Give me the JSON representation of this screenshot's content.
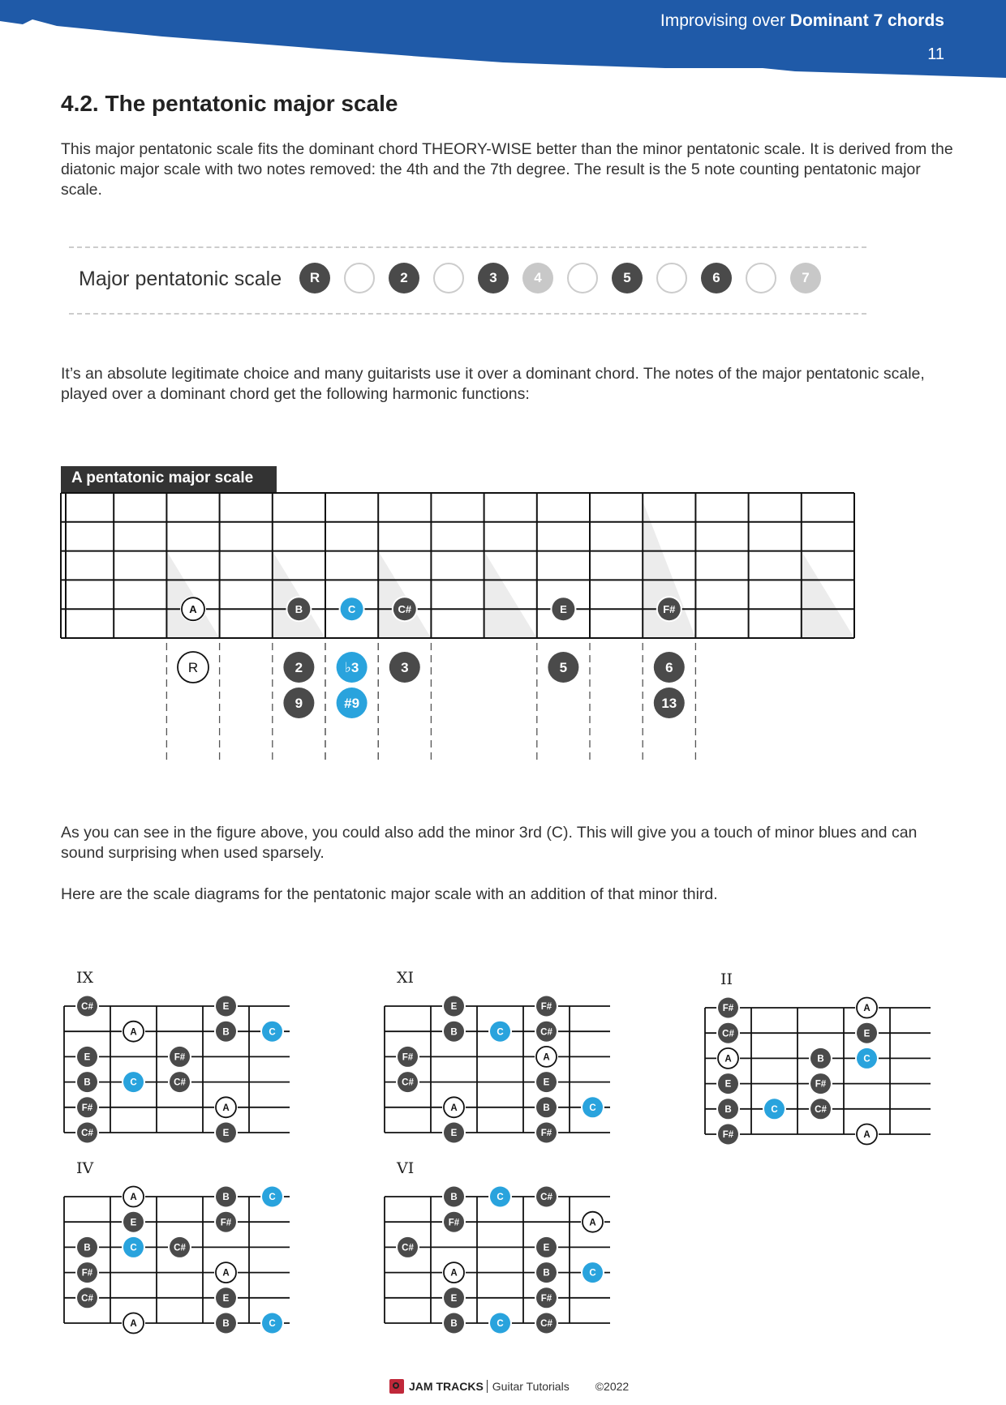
{
  "header": {
    "title_light": "Improvising over ",
    "title_bold": "Dominant 7 chords",
    "page_number": "11",
    "brand_color": "#1f5aa8"
  },
  "section": {
    "heading": "4.2. The pentatonic major scale",
    "intro": "This major pentatonic scale fits the dominant chord THEORY-WISE better than the minor pentatonic scale. It is derived from the diatonic major scale with two notes removed: the 4th and the 7th degree. The result is the 5 note counting pentatonic major scale."
  },
  "scale_strip": {
    "label": "Major pentatonic scale",
    "degrees": [
      {
        "label": "R",
        "state": "in"
      },
      {
        "label": "",
        "state": "empty"
      },
      {
        "label": "2",
        "state": "in"
      },
      {
        "label": "",
        "state": "empty"
      },
      {
        "label": "3",
        "state": "in"
      },
      {
        "label": "4",
        "state": "out"
      },
      {
        "label": "",
        "state": "empty"
      },
      {
        "label": "5",
        "state": "in"
      },
      {
        "label": "",
        "state": "empty"
      },
      {
        "label": "6",
        "state": "in"
      },
      {
        "label": "",
        "state": "empty"
      },
      {
        "label": "7",
        "state": "out"
      }
    ]
  },
  "para2": "It’s  an absolute legitimate choice and many guitarists use it over a dominant chord. The notes of the major pentatonic scale, played over a dominant chord get the following harmonic functions:",
  "fretboard": {
    "title": "A pentatonic major scale",
    "marker_frets": [
      3,
      5,
      7,
      9,
      12,
      15
    ],
    "notes": [
      {
        "fret": 3,
        "name": "A",
        "type": "root"
      },
      {
        "fret": 5,
        "name": "B",
        "type": "note"
      },
      {
        "fret": 6,
        "name": "C",
        "type": "blue"
      },
      {
        "fret": 7,
        "name": "C#",
        "type": "note"
      },
      {
        "fret": 10,
        "name": "E",
        "type": "note"
      },
      {
        "fret": 12,
        "name": "F#",
        "type": "note"
      }
    ],
    "functions": [
      {
        "fret": 3,
        "labels": [
          "R"
        ],
        "type": "root"
      },
      {
        "fret": 5,
        "labels": [
          "2",
          "9"
        ],
        "type": "note"
      },
      {
        "fret": 6,
        "labels": [
          "♭3",
          "#9"
        ],
        "type": "blue"
      },
      {
        "fret": 7,
        "labels": [
          "3"
        ],
        "type": "note"
      },
      {
        "fret": 10,
        "labels": [
          "5"
        ],
        "type": "note"
      },
      {
        "fret": 12,
        "labels": [
          "6",
          "13"
        ],
        "type": "note"
      }
    ]
  },
  "para3": "As you can see in the figure above, you could also add the minor 3rd (C). This will give you a touch of minor blues and can sound surprising when used sparsely.",
  "para4": "Here are the scale diagrams for the pentatonic major scale with an addition of that minor third.",
  "diagrams": [
    {
      "position": "IX",
      "notes": [
        {
          "s": 0,
          "c": 0,
          "n": "C#",
          "t": "note"
        },
        {
          "s": 0,
          "c": 3,
          "n": "E",
          "t": "note"
        },
        {
          "s": 1,
          "c": 1,
          "n": "A",
          "t": "root"
        },
        {
          "s": 1,
          "c": 3,
          "n": "B",
          "t": "note"
        },
        {
          "s": 1,
          "c": 4,
          "n": "C",
          "t": "blue"
        },
        {
          "s": 2,
          "c": 0,
          "n": "E",
          "t": "note"
        },
        {
          "s": 2,
          "c": 2,
          "n": "F#",
          "t": "note"
        },
        {
          "s": 3,
          "c": 0,
          "n": "B",
          "t": "note"
        },
        {
          "s": 3,
          "c": 1,
          "n": "C",
          "t": "blue"
        },
        {
          "s": 3,
          "c": 2,
          "n": "C#",
          "t": "note"
        },
        {
          "s": 4,
          "c": 0,
          "n": "F#",
          "t": "note"
        },
        {
          "s": 4,
          "c": 3,
          "n": "A",
          "t": "root"
        },
        {
          "s": 5,
          "c": 0,
          "n": "C#",
          "t": "note"
        },
        {
          "s": 5,
          "c": 3,
          "n": "E",
          "t": "note"
        }
      ]
    },
    {
      "position": "XI",
      "notes": [
        {
          "s": 0,
          "c": 1,
          "n": "E",
          "t": "note"
        },
        {
          "s": 0,
          "c": 3,
          "n": "F#",
          "t": "note"
        },
        {
          "s": 1,
          "c": 1,
          "n": "B",
          "t": "note"
        },
        {
          "s": 1,
          "c": 2,
          "n": "C",
          "t": "blue"
        },
        {
          "s": 1,
          "c": 3,
          "n": "C#",
          "t": "note"
        },
        {
          "s": 2,
          "c": 0,
          "n": "F#",
          "t": "note"
        },
        {
          "s": 2,
          "c": 3,
          "n": "A",
          "t": "root"
        },
        {
          "s": 3,
          "c": 0,
          "n": "C#",
          "t": "note"
        },
        {
          "s": 3,
          "c": 3,
          "n": "E",
          "t": "note"
        },
        {
          "s": 4,
          "c": 1,
          "n": "A",
          "t": "root"
        },
        {
          "s": 4,
          "c": 3,
          "n": "B",
          "t": "note"
        },
        {
          "s": 4,
          "c": 4,
          "n": "C",
          "t": "blue"
        },
        {
          "s": 5,
          "c": 1,
          "n": "E",
          "t": "note"
        },
        {
          "s": 5,
          "c": 3,
          "n": "F#",
          "t": "note"
        }
      ]
    },
    {
      "position": "II",
      "notes": [
        {
          "s": 0,
          "c": 0,
          "n": "F#",
          "t": "note"
        },
        {
          "s": 0,
          "c": 3,
          "n": "A",
          "t": "root"
        },
        {
          "s": 1,
          "c": 0,
          "n": "C#",
          "t": "note"
        },
        {
          "s": 1,
          "c": 3,
          "n": "E",
          "t": "note"
        },
        {
          "s": 2,
          "c": 0,
          "n": "A",
          "t": "root"
        },
        {
          "s": 2,
          "c": 2,
          "n": "B",
          "t": "note"
        },
        {
          "s": 2,
          "c": 3,
          "n": "C",
          "t": "blue"
        },
        {
          "s": 3,
          "c": 0,
          "n": "E",
          "t": "note"
        },
        {
          "s": 3,
          "c": 2,
          "n": "F#",
          "t": "note"
        },
        {
          "s": 4,
          "c": 0,
          "n": "B",
          "t": "note"
        },
        {
          "s": 4,
          "c": 1,
          "n": "C",
          "t": "blue"
        },
        {
          "s": 4,
          "c": 2,
          "n": "C#",
          "t": "note"
        },
        {
          "s": 5,
          "c": 0,
          "n": "F#",
          "t": "note"
        },
        {
          "s": 5,
          "c": 3,
          "n": "A",
          "t": "root"
        }
      ]
    },
    {
      "position": "IV",
      "notes": [
        {
          "s": 0,
          "c": 1,
          "n": "A",
          "t": "root"
        },
        {
          "s": 0,
          "c": 3,
          "n": "B",
          "t": "note"
        },
        {
          "s": 0,
          "c": 4,
          "n": "C",
          "t": "blue"
        },
        {
          "s": 1,
          "c": 1,
          "n": "E",
          "t": "note"
        },
        {
          "s": 1,
          "c": 3,
          "n": "F#",
          "t": "note"
        },
        {
          "s": 2,
          "c": 0,
          "n": "B",
          "t": "note"
        },
        {
          "s": 2,
          "c": 1,
          "n": "C",
          "t": "blue"
        },
        {
          "s": 2,
          "c": 2,
          "n": "C#",
          "t": "note"
        },
        {
          "s": 3,
          "c": 0,
          "n": "F#",
          "t": "note"
        },
        {
          "s": 3,
          "c": 3,
          "n": "A",
          "t": "root"
        },
        {
          "s": 4,
          "c": 0,
          "n": "C#",
          "t": "note"
        },
        {
          "s": 4,
          "c": 3,
          "n": "E",
          "t": "note"
        },
        {
          "s": 5,
          "c": 1,
          "n": "A",
          "t": "root"
        },
        {
          "s": 5,
          "c": 3,
          "n": "B",
          "t": "note"
        },
        {
          "s": 5,
          "c": 4,
          "n": "C",
          "t": "blue"
        }
      ]
    },
    {
      "position": "VI",
      "notes": [
        {
          "s": 0,
          "c": 1,
          "n": "B",
          "t": "note"
        },
        {
          "s": 0,
          "c": 2,
          "n": "C",
          "t": "blue"
        },
        {
          "s": 0,
          "c": 3,
          "n": "C#",
          "t": "note"
        },
        {
          "s": 1,
          "c": 1,
          "n": "F#",
          "t": "note"
        },
        {
          "s": 1,
          "c": 4,
          "n": "A",
          "t": "root"
        },
        {
          "s": 2,
          "c": 0,
          "n": "C#",
          "t": "note"
        },
        {
          "s": 2,
          "c": 3,
          "n": "E",
          "t": "note"
        },
        {
          "s": 3,
          "c": 1,
          "n": "A",
          "t": "root"
        },
        {
          "s": 3,
          "c": 3,
          "n": "B",
          "t": "note"
        },
        {
          "s": 3,
          "c": 4,
          "n": "C",
          "t": "blue"
        },
        {
          "s": 4,
          "c": 1,
          "n": "E",
          "t": "note"
        },
        {
          "s": 4,
          "c": 3,
          "n": "F#",
          "t": "note"
        },
        {
          "s": 5,
          "c": 1,
          "n": "B",
          "t": "note"
        },
        {
          "s": 5,
          "c": 2,
          "n": "C",
          "t": "blue"
        },
        {
          "s": 5,
          "c": 3,
          "n": "C#",
          "t": "note"
        }
      ]
    }
  ],
  "footer": {
    "brand": "JAM TRACKS",
    "product": "Guitar Tutorials",
    "copyright": "©2022"
  },
  "colors": {
    "note": "#4a4a4a",
    "blue": "#29a3dd",
    "root_fill": "#ffffff",
    "out_of_scale": "#c8c8c8"
  }
}
